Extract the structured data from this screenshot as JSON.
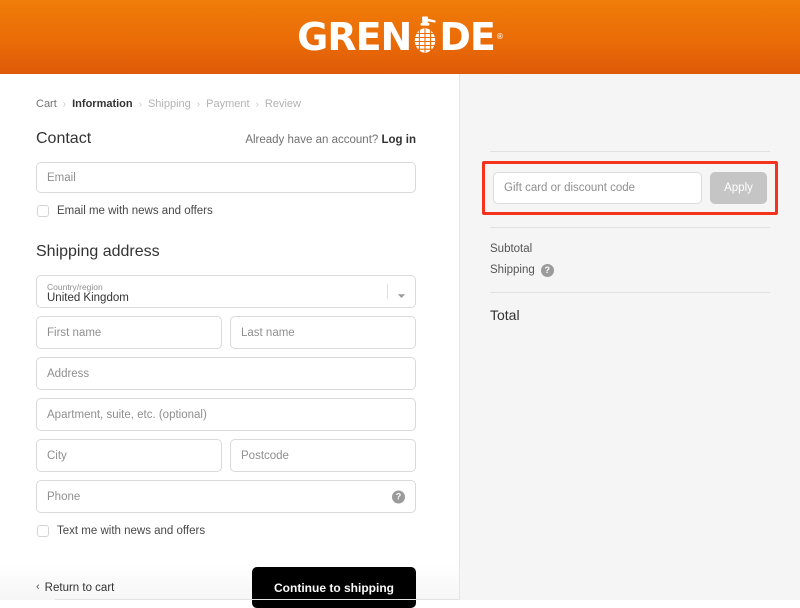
{
  "header": {
    "brand_prefix": "GREN",
    "brand_suffix": "DE",
    "brand_tm": "®",
    "brand_full": "GRENADE",
    "gradient_top": "#f07d09",
    "gradient_bottom": "#df5a08"
  },
  "breadcrumb": {
    "items": [
      {
        "label": "Cart",
        "state": "link"
      },
      {
        "label": "Information",
        "state": "active"
      },
      {
        "label": "Shipping",
        "state": "dim"
      },
      {
        "label": "Payment",
        "state": "dim"
      },
      {
        "label": "Review",
        "state": "dim"
      }
    ],
    "separator": "›"
  },
  "contact": {
    "title": "Contact",
    "account_note": "Already have an account?",
    "login_label": "Log in",
    "email_placeholder": "Email",
    "newsletter_label": "Email me with news and offers",
    "newsletter_checked": false
  },
  "shipping": {
    "title": "Shipping address",
    "country_label": "Country/region",
    "country_value": "United Kingdom",
    "first_name_placeholder": "First name",
    "last_name_placeholder": "Last name",
    "address_placeholder": "Address",
    "apartment_placeholder": "Apartment, suite, etc. (optional)",
    "city_placeholder": "City",
    "postcode_placeholder": "Postcode",
    "phone_placeholder": "Phone",
    "phone_help": "?",
    "sms_label": "Text me with news and offers",
    "sms_checked": false
  },
  "actions": {
    "return_label": "Return to cart",
    "return_chevron": "‹",
    "continue_label": "Continue to shipping"
  },
  "summary": {
    "discount_placeholder": "Gift card or discount code",
    "apply_label": "Apply",
    "subtotal_label": "Subtotal",
    "subtotal_value": "",
    "shipping_label": "Shipping",
    "shipping_value": "",
    "shipping_help": "?",
    "total_label": "Total",
    "total_value": ""
  },
  "annotation": {
    "color": "#f5331d",
    "target": "discount-code-field"
  }
}
